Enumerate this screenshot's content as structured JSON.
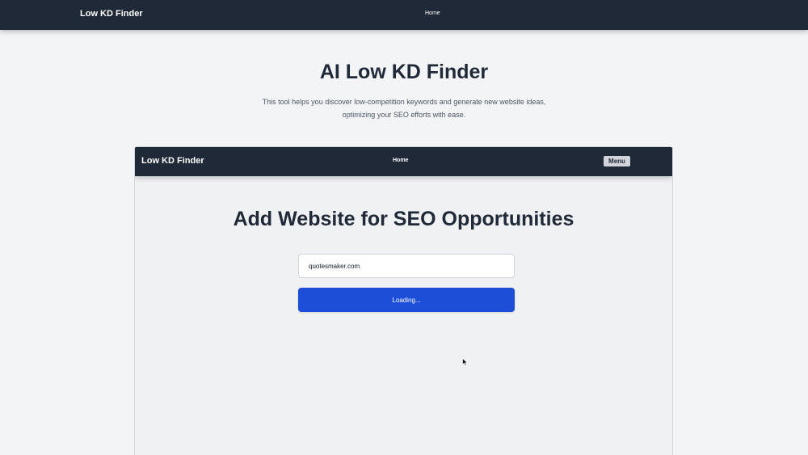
{
  "header": {
    "brand": "Low KD Finder",
    "nav_home": "Home"
  },
  "hero": {
    "title": "AI Low KD Finder",
    "description": "This tool helps you discover low-competition keywords and generate new website ideas, optimizing your SEO efforts with ease."
  },
  "embedded_app": {
    "navbar": {
      "brand": "Low KD Finder",
      "nav_home": "Home",
      "menu_button": "Menu"
    },
    "title": "Add Website for SEO Opportunities",
    "website_input": {
      "value": "quotesmaker.com"
    },
    "submit_button": "Loading..."
  },
  "colors": {
    "navbar_bg": "#1f2937",
    "page_bg": "#f3f4f6",
    "button_primary": "#1d4ed8"
  },
  "icons": {
    "cursor": "mouse-pointer-icon"
  }
}
